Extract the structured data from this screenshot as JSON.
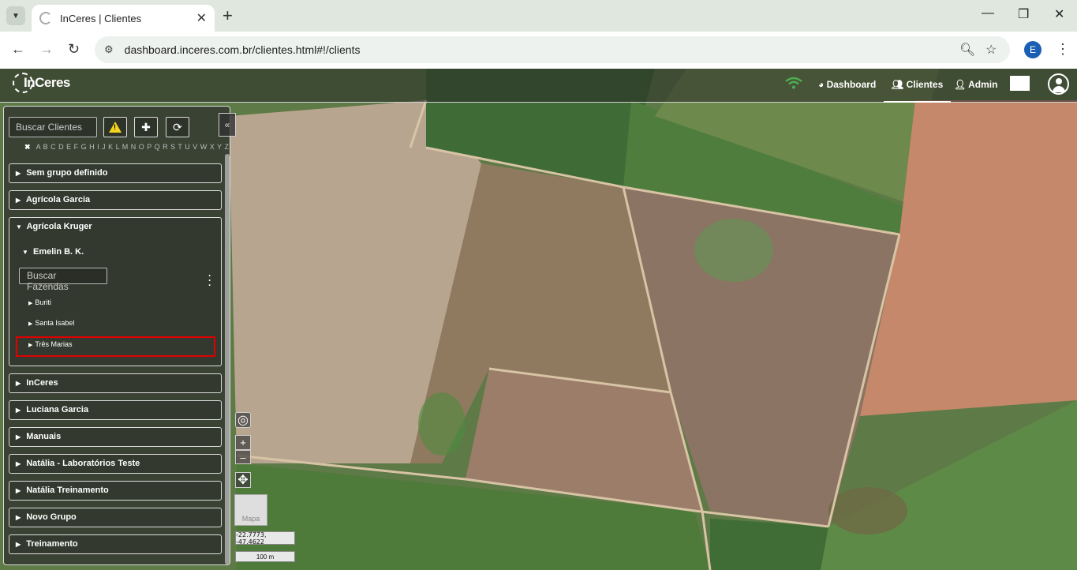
{
  "browser": {
    "tab_title": "InCeres | Clientes",
    "url": "dashboard.inceres.com.br/clientes.html#!/clients",
    "profile_initial": "E"
  },
  "app": {
    "logo_text": "InCeres",
    "nav": {
      "dashboard": "Dashboard",
      "clients": "Clientes",
      "admin": "Admin"
    }
  },
  "sidebar": {
    "search_placeholder": "Buscar Clientes",
    "alphabet_clear": "✖",
    "alphabet": "A B C D E F G H I J K L M N O P Q R S T U V W X Y Z",
    "groups_top": [
      {
        "label": "Sem grupo definido"
      },
      {
        "label": "Agrícola Garcia"
      }
    ],
    "open_group": {
      "label": "Agrícola Kruger",
      "client": "Emelin B. K.",
      "farm_search_placeholder": "Buscar Fazendas",
      "farms": [
        {
          "label": "Buriti"
        },
        {
          "label": "Santa Isabel"
        },
        {
          "label": "Três Marias"
        }
      ]
    },
    "groups_bottom": [
      {
        "label": "InCeres"
      },
      {
        "label": "Luciana Garcia"
      },
      {
        "label": "Manuais"
      },
      {
        "label": "Natália - Laboratórios Teste"
      },
      {
        "label": "Natália Treinamento"
      },
      {
        "label": "Novo Grupo"
      },
      {
        "label": "Treinamento"
      }
    ]
  },
  "map": {
    "coords": "-22.7773, -47.4622",
    "scale": "100 m",
    "basemap_label": "Mapa",
    "zoom_in": "+",
    "zoom_out": "–"
  },
  "colors": {
    "highlight": "#e00000",
    "wifi": "#4caf50",
    "warning": "#f3d320"
  }
}
